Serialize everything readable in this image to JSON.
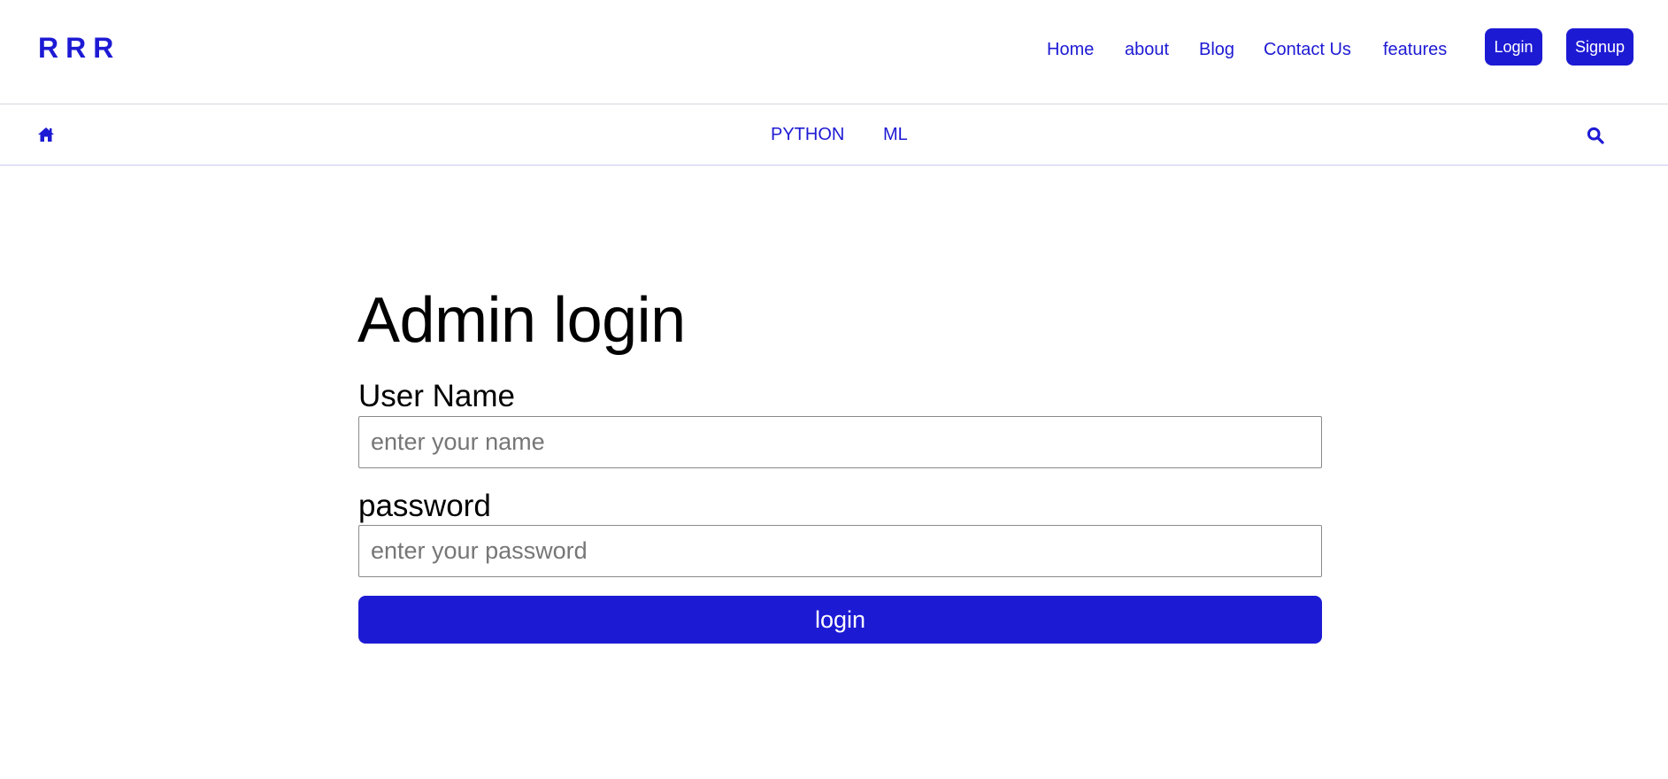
{
  "brand": {
    "text": "RRR"
  },
  "nav": {
    "links": [
      "Home",
      "about",
      "Blog",
      "Contact Us",
      "features"
    ],
    "login_label": "Login",
    "signup_label": "Signup"
  },
  "subnav": {
    "home_icon": "home-icon",
    "links": [
      "PYTHON",
      "ML"
    ],
    "search_icon": "search-icon"
  },
  "form": {
    "title": "Admin login",
    "username_label": "User Name",
    "username_placeholder": "enter your name",
    "username_value": "",
    "password_label": "password",
    "password_placeholder": "enter your password",
    "password_value": "",
    "submit_label": "login"
  },
  "colors": {
    "accent": "#1d1ad4",
    "background": "#ffffff",
    "text": "#000000"
  }
}
